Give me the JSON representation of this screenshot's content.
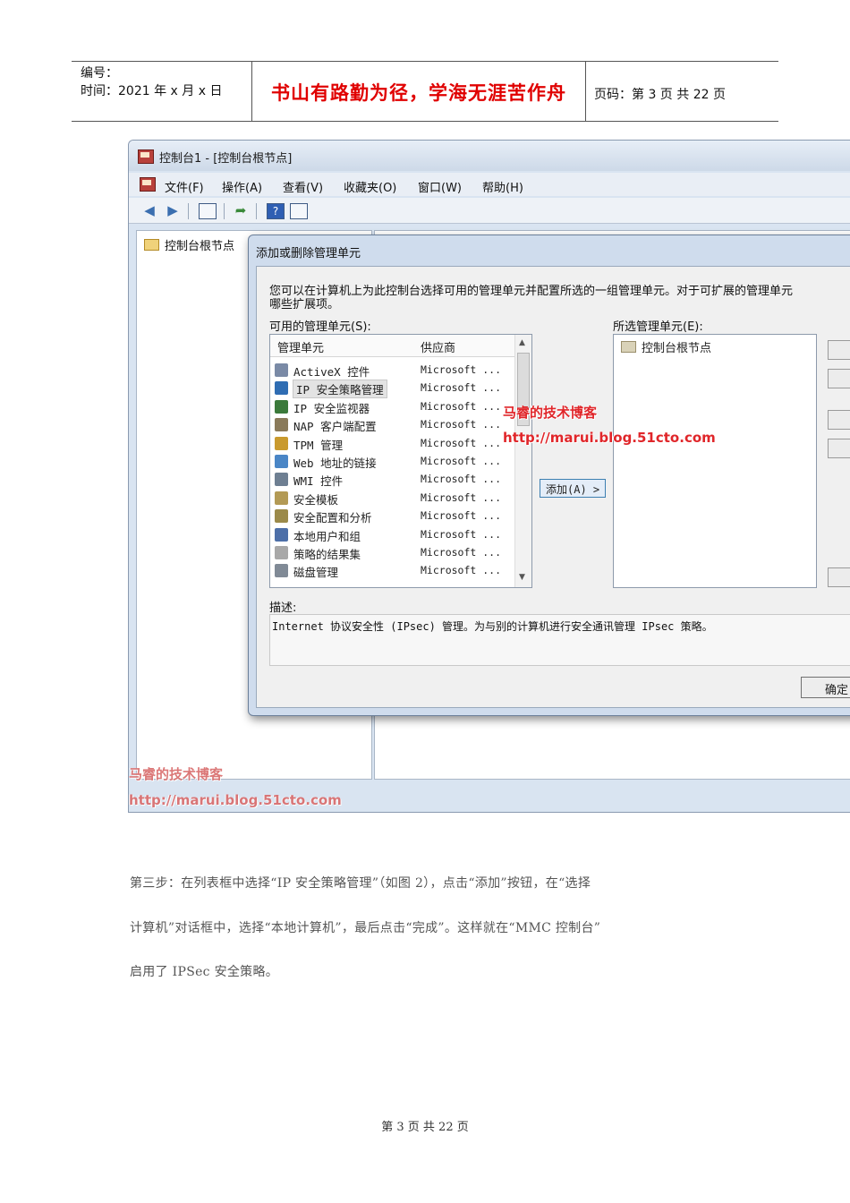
{
  "header": {
    "number_label": "编号：",
    "time_label": "时间：2021 年 x 月 x 日",
    "motto": "书山有路勤为径，学海无涯苦作舟",
    "page_label": "页码：第 3 页  共 22 页"
  },
  "window": {
    "title": "控制台1 - [控制台根节点]",
    "menu": [
      "文件(F)",
      "操作(A)",
      "查看(V)",
      "收藏夹(O)",
      "窗口(W)",
      "帮助(H)"
    ],
    "tree_root": "控制台根节点"
  },
  "dialog": {
    "title": "添加或删除管理单元",
    "intro_line1": "您可以在计算机上为此控制台选择可用的管理单元并配置所选的一组管理单元。对于可扩展的管理单元",
    "intro_line2": "哪些扩展项。",
    "available_label": "可用的管理单元(S):",
    "selected_label": "所选管理单元(E):",
    "col_snapin": "管理单元",
    "col_vendor": "供应商",
    "snapins": [
      {
        "name": "ActiveX 控件",
        "vendor": "Microsoft ...",
        "icon_color": "#7a8aa6"
      },
      {
        "name": "IP 安全策略管理",
        "vendor": "Microsoft ...",
        "icon_color": "#2f6db3"
      },
      {
        "name": "IP 安全监视器",
        "vendor": "Microsoft ...",
        "icon_color": "#3b7a3b"
      },
      {
        "name": "NAP 客户端配置",
        "vendor": "Microsoft ...",
        "icon_color": "#8a7a5a"
      },
      {
        "name": "TPM 管理",
        "vendor": "Microsoft ...",
        "icon_color": "#c99a2e"
      },
      {
        "name": "Web 地址的链接",
        "vendor": "Microsoft ...",
        "icon_color": "#4a86c6"
      },
      {
        "name": "WMI 控件",
        "vendor": "Microsoft ...",
        "icon_color": "#6e7f92"
      },
      {
        "name": "安全模板",
        "vendor": "Microsoft ...",
        "icon_color": "#b39a55"
      },
      {
        "name": "安全配置和分析",
        "vendor": "Microsoft ...",
        "icon_color": "#9b8a4a"
      },
      {
        "name": "本地用户和组",
        "vendor": "Microsoft ...",
        "icon_color": "#4d6fa8"
      },
      {
        "name": "策略的结果集",
        "vendor": "Microsoft ...",
        "icon_color": "#a8a8a8"
      },
      {
        "name": "磁盘管理",
        "vendor": "Microsoft ...",
        "icon_color": "#808a96"
      }
    ],
    "selected_item": "控制台根节点",
    "add_button": "添加(A) >",
    "desc_label": "描述:",
    "description": "Internet 协议安全性 (IPsec) 管理。为与别的计算机进行安全通讯管理 IPsec 策略。",
    "ok_button": "确定"
  },
  "watermark": {
    "name": "马睿的技术博客",
    "url": "http://marui.blog.51cto.com"
  },
  "body": {
    "line1": "第三步：在列表框中选择“IP 安全策略管理”（如图 2），点击“添加”按钮，在“选择",
    "line2": "计算机”对话框中，选择“本地计算机”，最后点击“完成”。这样就在“MMC 控制台”",
    "line3": "启用了 IPSec 安全策略。"
  },
  "footer": "第 3 页 共 22 页"
}
